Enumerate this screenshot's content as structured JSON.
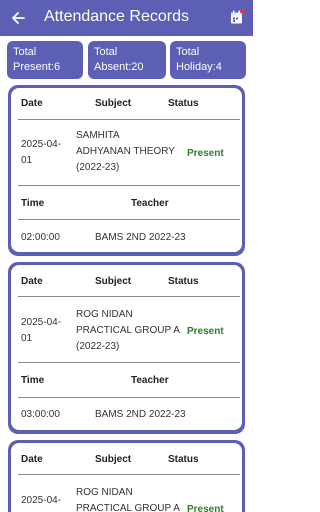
{
  "header": {
    "title": "Attendance Records"
  },
  "summary": {
    "present": {
      "line1": "Total",
      "line2": "Present:6"
    },
    "absent": {
      "line1": "Total",
      "line2": "Absent:20"
    },
    "holiday": {
      "line1": "Total",
      "line2": "Holiday:4"
    }
  },
  "table_headers": {
    "date": "Date",
    "subject": "Subject",
    "status": "Status",
    "time": "Time",
    "teacher": "Teacher"
  },
  "records": [
    {
      "date_line1": "2025-04-",
      "date_line2": "01",
      "subject_line1": "SAMHITA",
      "subject_line2": "ADHYANAN THEORY",
      "subject_line3": "(2022-23)",
      "status": "Present",
      "time": "02:00:00",
      "teacher": "BAMS 2ND 2022-23"
    },
    {
      "date_line1": "2025-04-",
      "date_line2": "01",
      "subject_line1": "ROG NIDAN",
      "subject_line2": "PRACTICAL GROUP A",
      "subject_line3": "(2022-23)",
      "status": "Present",
      "time": "03:00:00",
      "teacher": "BAMS 2ND 2022-23"
    },
    {
      "date_line1": "2025-04-",
      "date_line2": "",
      "subject_line1": "ROG NIDAN",
      "subject_line2": "PRACTICAL GROUP A",
      "subject_line3": "",
      "status": "Present",
      "time": "",
      "teacher": ""
    }
  ],
  "colors": {
    "primary": "#5c5fb3",
    "present": "#2e7d32",
    "notification_dot": "#e53935"
  },
  "icons": {
    "back": "arrow-left-icon",
    "calendar": "calendar-icon"
  }
}
